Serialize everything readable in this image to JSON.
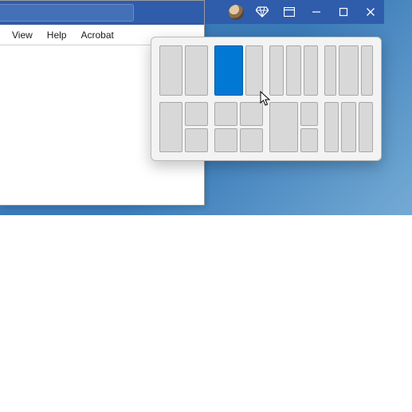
{
  "colors": {
    "titlebar": "#2f5cab",
    "accent": "#0078d4"
  },
  "menubar": {
    "items": [
      "View",
      "Help",
      "Acrobat"
    ]
  },
  "caption": {
    "avatar": "user-avatar",
    "diamond": "premium-diamond-icon",
    "display": "ribbon-display-options-icon",
    "minimize": "minimize-icon",
    "maximize": "maximize-icon",
    "close": "close-icon"
  },
  "snap": {
    "rows": 2,
    "cols": 4,
    "selected": {
      "layout": 2,
      "zone": 1
    },
    "layouts": [
      {
        "id": 1,
        "name": "two-equal",
        "zones": 2
      },
      {
        "id": 2,
        "name": "two-wide-left",
        "zones": 2
      },
      {
        "id": 3,
        "name": "three-equal",
        "zones": 3
      },
      {
        "id": 4,
        "name": "three-wide-center",
        "zones": 3
      },
      {
        "id": 5,
        "name": "left-half-right-stack",
        "zones": 3
      },
      {
        "id": 6,
        "name": "four-quad",
        "zones": 4
      },
      {
        "id": 7,
        "name": "wide-left-right-stack",
        "zones": 3
      },
      {
        "id": 8,
        "name": "three-equal-alt",
        "zones": 3
      }
    ]
  }
}
